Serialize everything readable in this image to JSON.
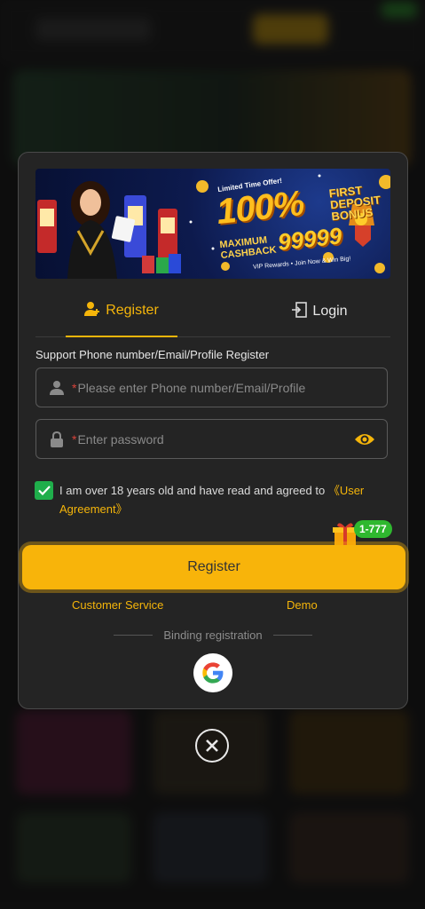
{
  "promo": {
    "tag": "Limited Time Offer!",
    "headline": "100%",
    "subheadline": "FIRST DEPOSIT BONUS",
    "cashback_label": "MAXIMUM CASHBACK",
    "cashback_amount": "99999",
    "footer": "VIP Rewards • Join Now & Win Big!"
  },
  "tabs": {
    "register": "Register",
    "login": "Login"
  },
  "form": {
    "hint": "Support Phone number/Email/Profile Register",
    "phone_placeholder": "Please enter Phone number/Email/Profile",
    "password_placeholder": "Enter password",
    "required_mark": "*",
    "agreement_text": "I am over 18 years old and have read and agreed to ",
    "agreement_link": "《User Agreement》",
    "agreement_checked": true
  },
  "gift_badge": "1-777",
  "register_button": "Register",
  "links": {
    "customer_service": "Customer Service",
    "demo": "Demo"
  },
  "binding_label": "Binding registration",
  "colors": {
    "accent": "#f5b50a",
    "checkbox": "#1fae4b",
    "badge": "#2fb82f"
  }
}
